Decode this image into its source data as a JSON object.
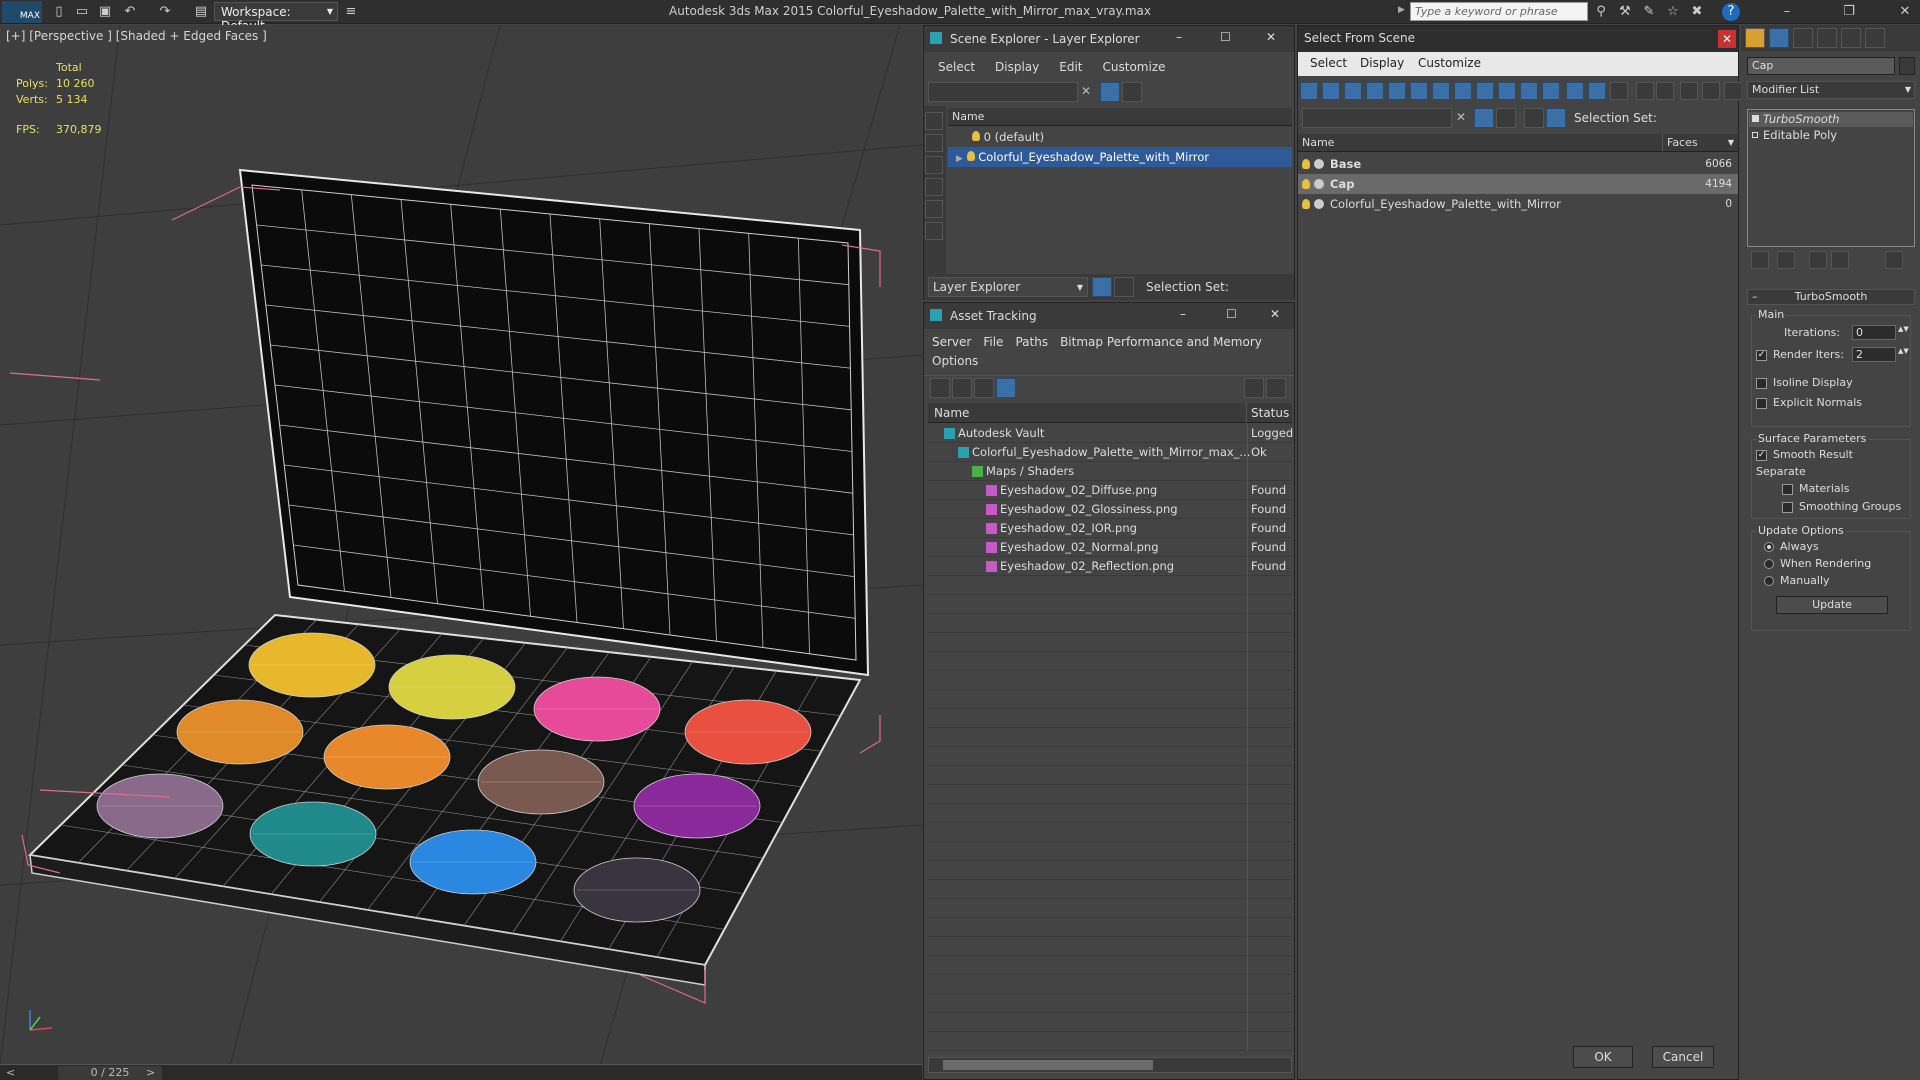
{
  "app": {
    "title": "Autodesk 3ds Max  2015    Colorful_Eyeshadow_Palette_with_Mirror_max_vray.max",
    "logo": "MAX",
    "workspace": "Workspace: Default",
    "search_placeholder": "Type a keyword or phrase"
  },
  "viewport": {
    "label": "[+] [Perspective ] [Shaded + Edged Faces ]",
    "stats": {
      "total_label": "Total",
      "polys_label": "Polys:",
      "polys": "10 260",
      "verts_label": "Verts:",
      "verts": "5 134",
      "fps_label": "FPS:",
      "fps": "370,879"
    },
    "timeline": {
      "frame": "0 / 225",
      "prev": "<",
      "next": ">"
    },
    "swatch_colors": [
      "#e8b82c",
      "#d6d040",
      "#e84a9a",
      "#ea5040",
      "#e08a2a",
      "#e8882a",
      "#7a5a50",
      "#8a2a9a",
      "#8a6a8a",
      "#208a8a",
      "#2a88e0",
      "#3a3440"
    ]
  },
  "scene_explorer": {
    "title": "Scene Explorer - Layer Explorer",
    "menu": [
      "Select",
      "Display",
      "Edit",
      "Customize"
    ],
    "col_name": "Name",
    "rows": [
      {
        "label": "0 (default)",
        "selected": false
      },
      {
        "label": "Colorful_Eyeshadow_Palette_with_Mirror",
        "selected": true
      }
    ],
    "footer_combo": "Layer Explorer",
    "selection_set": "Selection Set:"
  },
  "asset_tracking": {
    "title": "Asset Tracking",
    "menu": [
      "Server",
      "File",
      "Paths",
      "Bitmap Performance and Memory"
    ],
    "menu2": "Options",
    "col_name": "Name",
    "col_status": "Status",
    "rows": [
      {
        "name": "Autodesk Vault",
        "status": "Logged"
      },
      {
        "name": "Colorful_Eyeshadow_Palette_with_Mirror_max_...",
        "status": "Ok"
      },
      {
        "name": "Maps / Shaders",
        "status": ""
      },
      {
        "name": "Eyeshadow_02_Diffuse.png",
        "status": "Found"
      },
      {
        "name": "Eyeshadow_02_Glossiness.png",
        "status": "Found"
      },
      {
        "name": "Eyeshadow_02_IOR.png",
        "status": "Found"
      },
      {
        "name": "Eyeshadow_02_Normal.png",
        "status": "Found"
      },
      {
        "name": "Eyeshadow_02_Reflection.png",
        "status": "Found"
      }
    ]
  },
  "select_from_scene": {
    "title": "Select From Scene",
    "menu": [
      "Select",
      "Display",
      "Customize"
    ],
    "selection_set": "Selection Set:",
    "col_name": "Name",
    "col_faces": "Faces",
    "rows": [
      {
        "name": "Base",
        "faces": "6066",
        "selected": false
      },
      {
        "name": "Cap",
        "faces": "4194",
        "selected": true
      },
      {
        "name": "Colorful_Eyeshadow_Palette_with_Mirror",
        "faces": "0",
        "selected": false
      }
    ],
    "ok": "OK",
    "cancel": "Cancel"
  },
  "command_panel": {
    "object_name": "Cap",
    "modifier_list": "Modifier List",
    "stack": [
      "TurboSmooth",
      "Editable Poly"
    ],
    "rollout": "TurboSmooth",
    "main": "Main",
    "iterations_label": "Iterations:",
    "iterations": "0",
    "render_iters_label": "Render Iters:",
    "render_iters": "2",
    "isoline": "Isoline Display",
    "explicit": "Explicit Normals",
    "surface": "Surface Parameters",
    "smooth": "Smooth Result",
    "separate": "Separate",
    "materials": "Materials",
    "smoothing": "Smoothing Groups",
    "update_options": "Update Options",
    "always": "Always",
    "when_rendering": "When Rendering",
    "manually": "Manually",
    "update": "Update"
  }
}
